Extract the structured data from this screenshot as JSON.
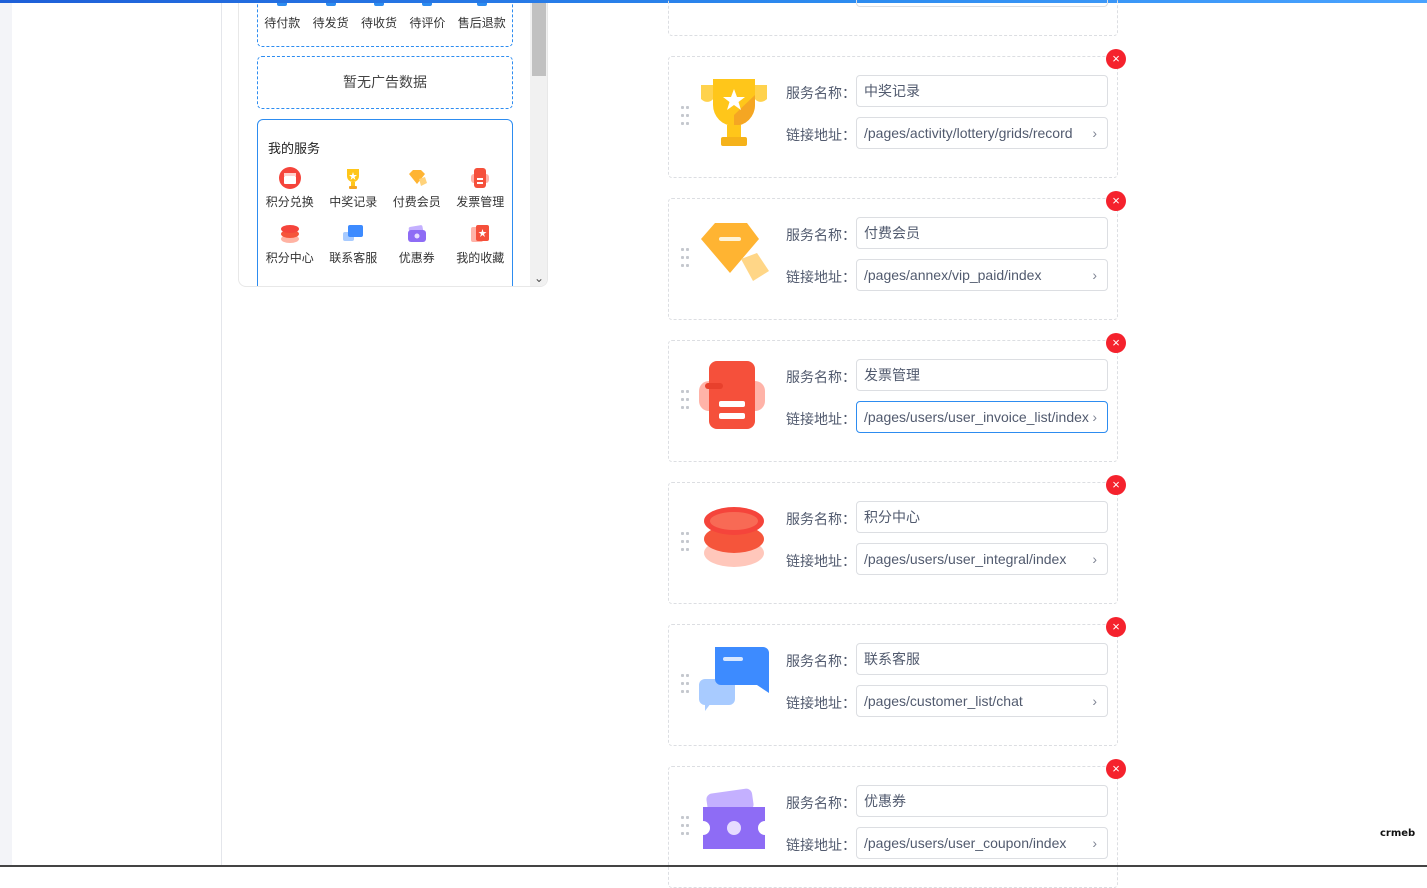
{
  "preview": {
    "orders": [
      "待付款",
      "待发货",
      "待收货",
      "待评价",
      "售后退款"
    ],
    "ad_empty": "暂无广告数据",
    "service_title": "我的服务",
    "services": [
      {
        "label": "积分兑换",
        "icon": "shop-icon"
      },
      {
        "label": "中奖记录",
        "icon": "trophy-icon"
      },
      {
        "label": "付费会员",
        "icon": "vip-icon"
      },
      {
        "label": "发票管理",
        "icon": "invoice-icon"
      },
      {
        "label": "积分中心",
        "icon": "coins-icon"
      },
      {
        "label": "联系客服",
        "icon": "chat-icon"
      },
      {
        "label": "优惠券",
        "icon": "coupon-icon"
      },
      {
        "label": "我的收藏",
        "icon": "favorite-icon"
      }
    ]
  },
  "form": {
    "name_label": "服务名称：",
    "link_label": "链接地址：",
    "items": [
      {
        "name": "中奖记录",
        "link": "/pages/activity/lottery/grids/record",
        "icon": "trophy-icon"
      },
      {
        "name": "付费会员",
        "link": "/pages/annex/vip_paid/index",
        "icon": "vip-icon"
      },
      {
        "name": "发票管理",
        "link": "/pages/users/user_invoice_list/index",
        "icon": "invoice-icon"
      },
      {
        "name": "积分中心",
        "link": "/pages/users/user_integral/index",
        "icon": "coins-icon"
      },
      {
        "name": "联系客服",
        "link": "/pages/customer_list/chat",
        "icon": "chat-icon"
      },
      {
        "name": "优惠券",
        "link": "/pages/users/user_coupon/index",
        "icon": "coupon-icon"
      }
    ]
  },
  "brand": "crmeb"
}
